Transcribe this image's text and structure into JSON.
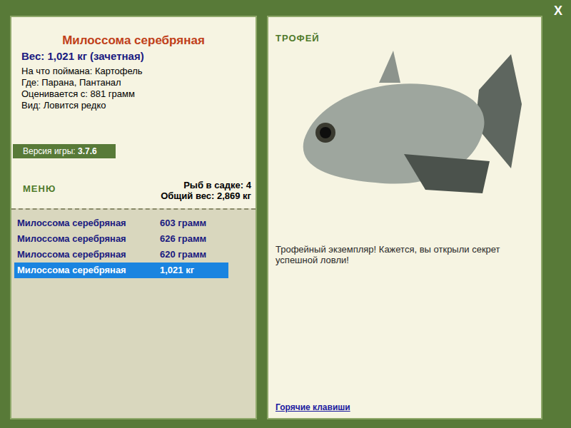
{
  "close": "X",
  "fish": {
    "name": "Милоссома серебряная",
    "weight": "Вес: 1,021 кг (зачетная)",
    "details": [
      "На что поймана: Картофель",
      "Где: Парана, Пантанал",
      "Оценивается с: 881 грамм",
      "Вид: Ловится редко"
    ]
  },
  "version": {
    "label": "Версия игры:",
    "value": "3.7.6"
  },
  "menu": "МЕНЮ",
  "keepnet": {
    "count": "Рыб в садке: 4",
    "total": "Общий вес: 2,869 кг"
  },
  "catch_list": [
    {
      "name": "Милоссома серебряная",
      "weight": "603 грамм",
      "selected": false
    },
    {
      "name": "Милоссома серебряная",
      "weight": "626 грамм",
      "selected": false
    },
    {
      "name": "Милоссома серебряная",
      "weight": "620 грамм",
      "selected": false
    },
    {
      "name": "Милоссома серебряная",
      "weight": "1,021 кг",
      "selected": true
    }
  ],
  "trophy": {
    "badge": "ТРОФЕЙ",
    "message": "Трофейный экземпляр! Кажется, вы открыли секрет успешной ловли!"
  },
  "hotkeys_link": "Горячие клавиши"
}
